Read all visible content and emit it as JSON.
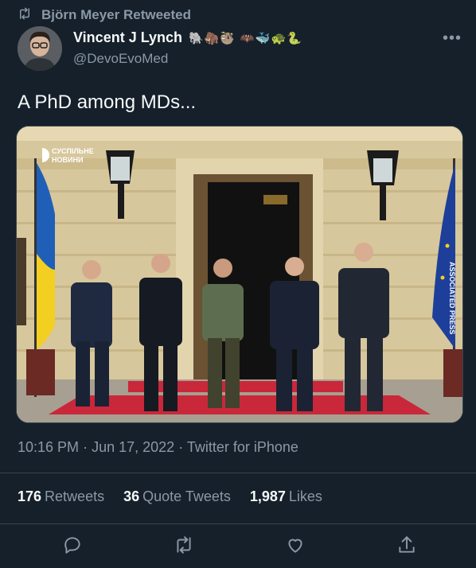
{
  "retweet": {
    "text": "Björn Meyer Retweeted"
  },
  "author": {
    "display_name": "Vincent J Lynch",
    "emojis": "🐘🦣🦥 🦇🐳🐢🐍",
    "handle": "@DevoEvoMed"
  },
  "tweet": {
    "text": "A PhD among MDs...",
    "time": "10:16 PM",
    "date": "Jun 17, 2022",
    "source": "Twitter for iPhone"
  },
  "photo": {
    "watermark_line1": "СУСПІЛЬНЕ",
    "watermark_line2": "НОВИНИ",
    "credit": "ASSOCIATED PRESS"
  },
  "stats": {
    "retweets_count": "176",
    "retweets_label": "Retweets",
    "quotes_count": "36",
    "quotes_label": "Quote Tweets",
    "likes_count": "1,987",
    "likes_label": "Likes"
  },
  "colors": {
    "background": "#15202b",
    "text_primary": "#f7f9f9",
    "text_secondary": "#8b98a5",
    "border": "#38444d"
  }
}
